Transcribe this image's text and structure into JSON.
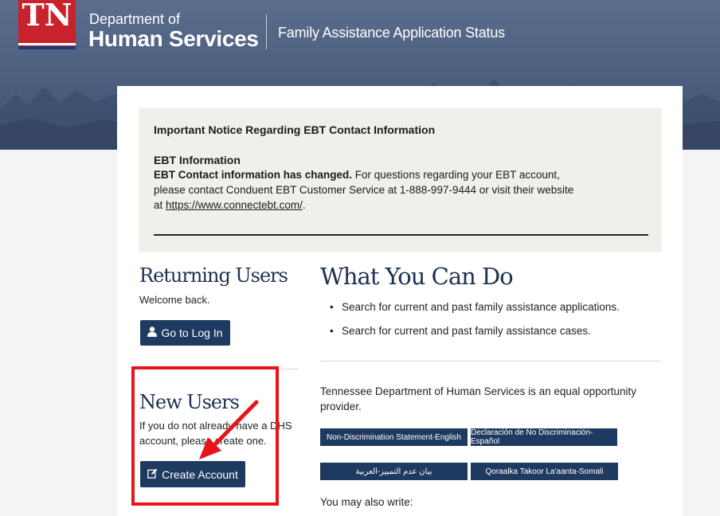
{
  "header": {
    "logo_text": "TN",
    "dept_small": "Department of",
    "dept_big": "Human Services",
    "app_title": "Family Assistance Application Status"
  },
  "notice": {
    "title": "Important Notice Regarding EBT Contact Information",
    "subtitle": "EBT Information",
    "bold_lead": "EBT Contact information has changed.",
    "text1": " For questions regarding your EBT account, please contact Conduent EBT Customer Service at 1-888-997-9444 or visit their website at ",
    "link": "https://www.connectebt.com/",
    "text2": "."
  },
  "returning": {
    "title": "Returning Users",
    "welcome": "Welcome back.",
    "login_label": "Go to Log In"
  },
  "new_users": {
    "title": "New Users",
    "text": "If you do not already have a DHS account, please create one.",
    "create_label": "Create Account"
  },
  "what": {
    "title": "What You Can Do",
    "items": [
      "Search for current and past family assistance applications.",
      "Search for current and past family assistance cases."
    ],
    "eo_text": "Tennessee Department of Human Services is an equal opportunity provider.",
    "buttons": [
      "Non-Discrimination Statement-English",
      "Declaración de No Discriminación-Español",
      "بيان عدم التمييز-العربية",
      "Qoraalka Takoor La'aanta-Somali"
    ],
    "write": "You may also write:"
  },
  "colors": {
    "brand_red": "#c8232c",
    "navy": "#1f3a60",
    "highlight": "#e8141b"
  }
}
